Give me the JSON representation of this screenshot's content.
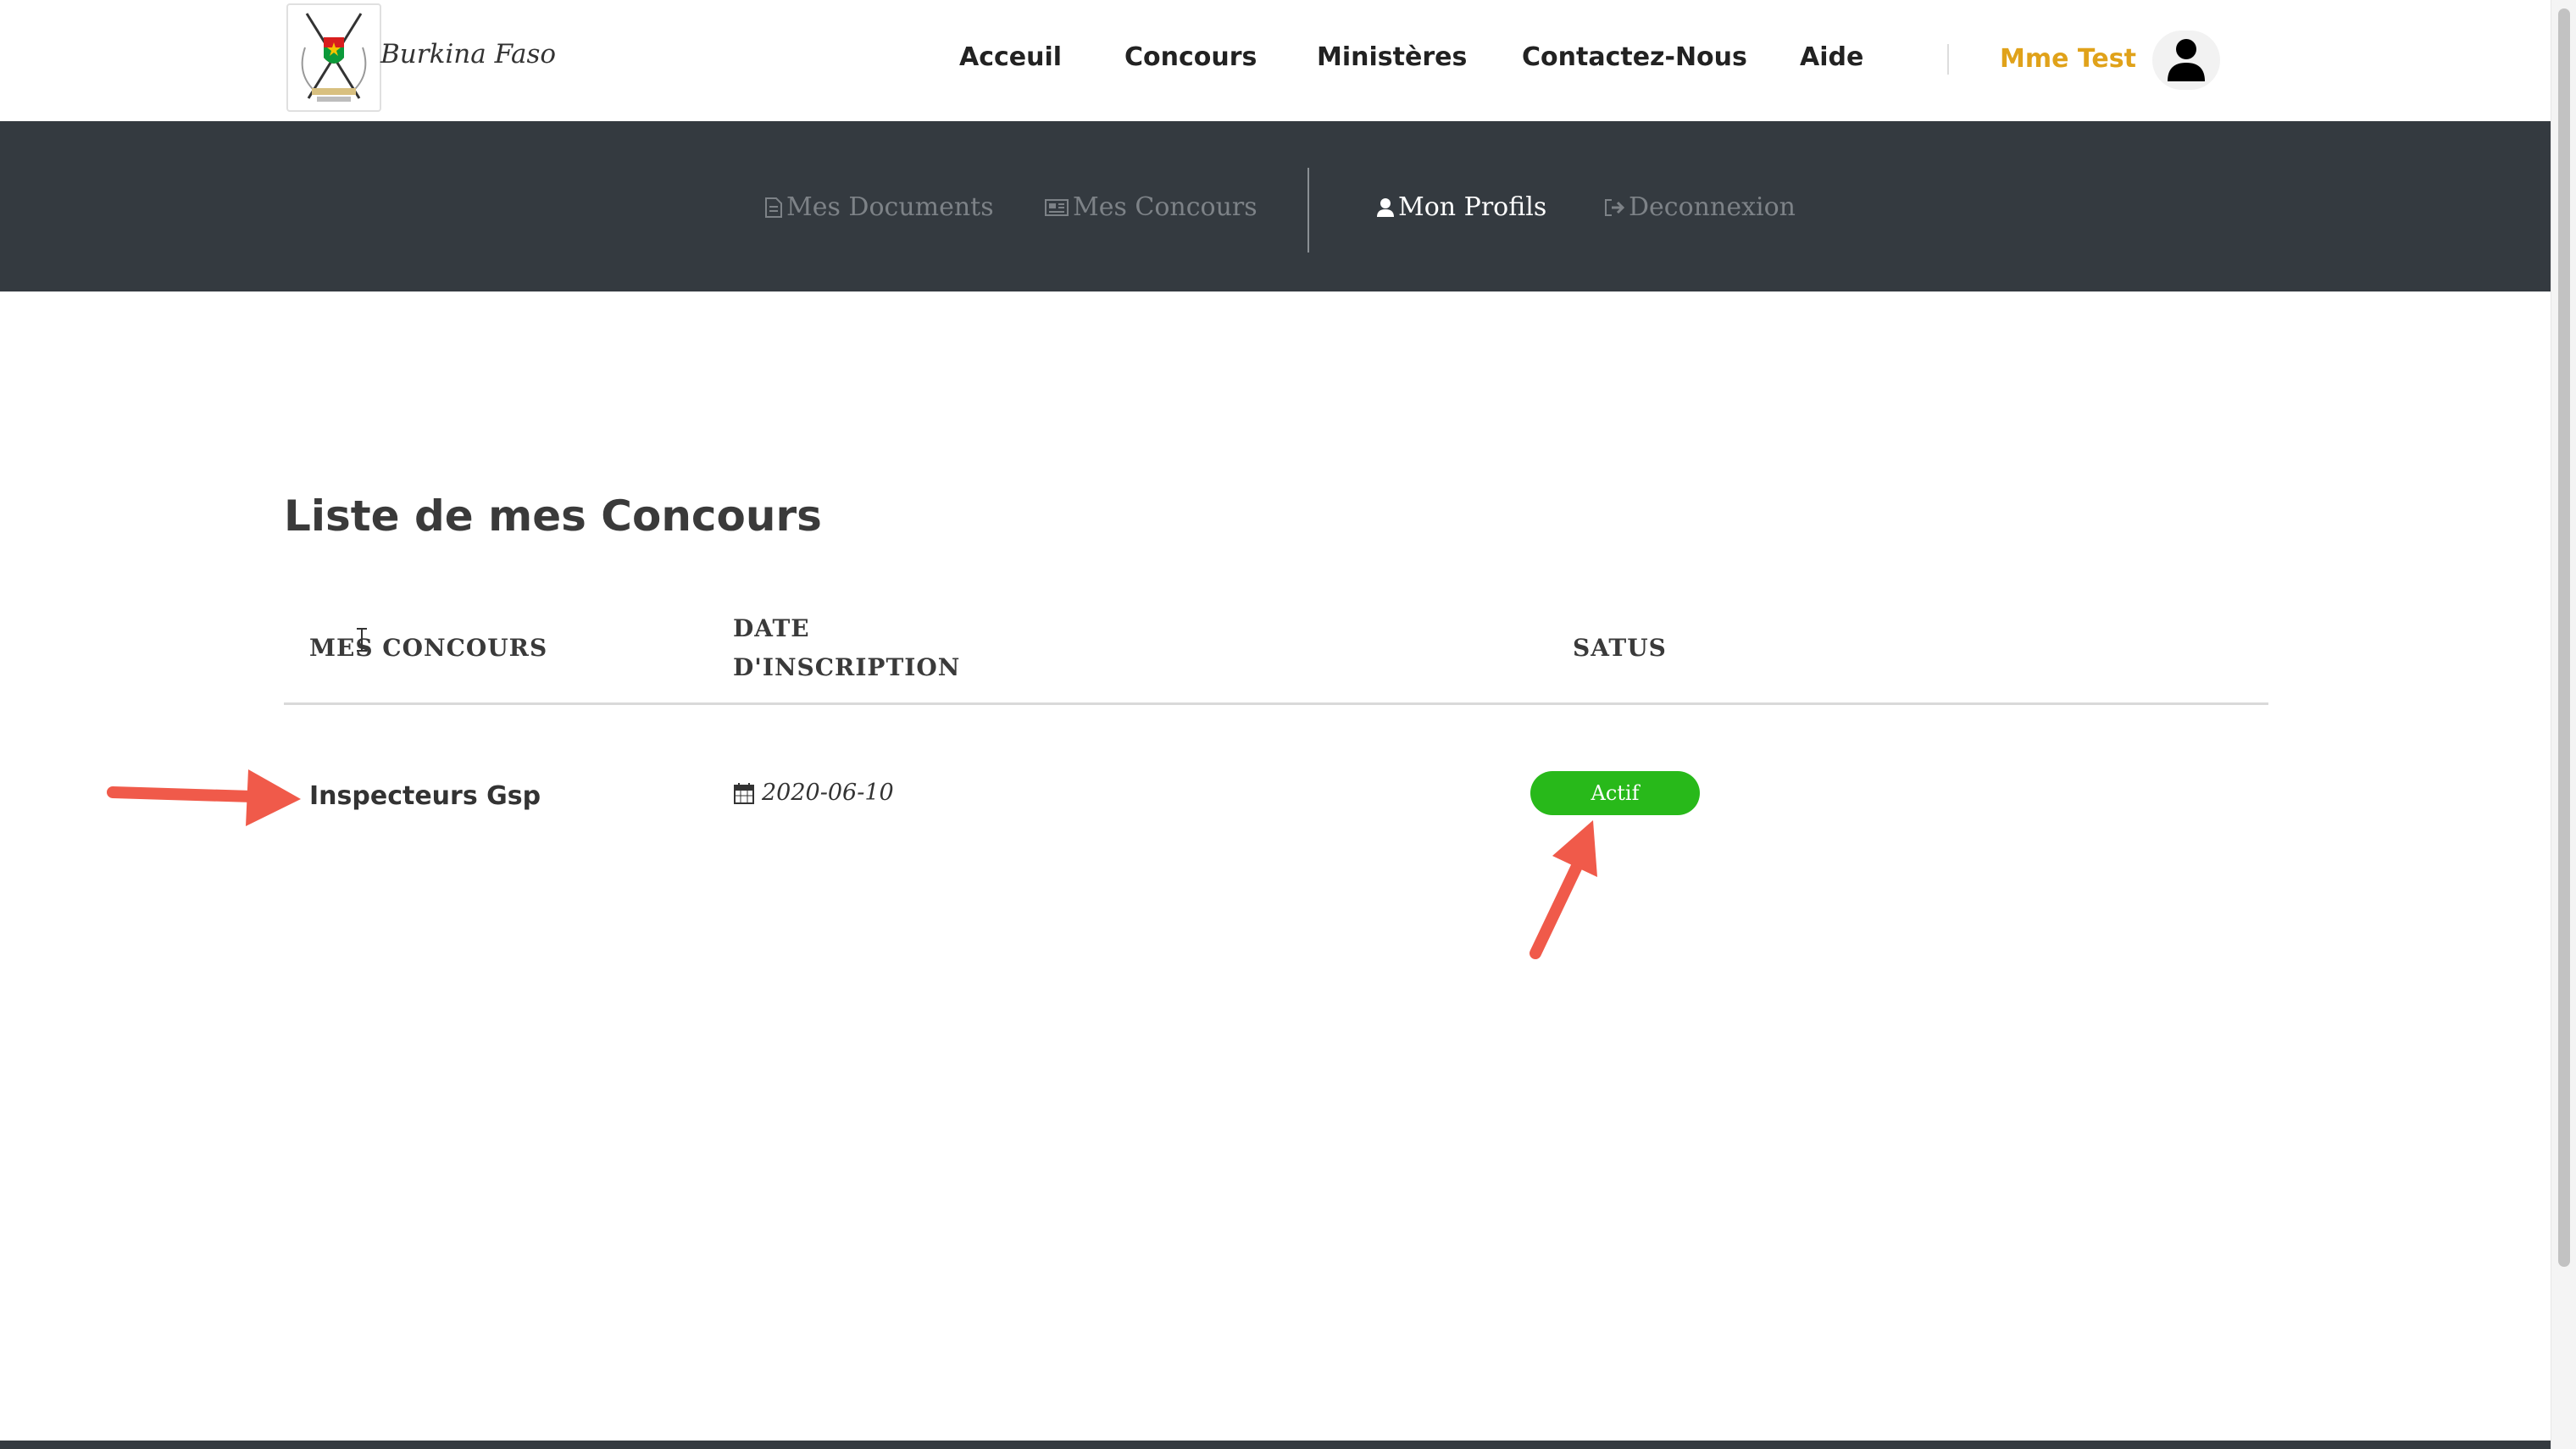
{
  "brand": {
    "name": "Burkina Faso"
  },
  "nav": {
    "items": [
      "Acceuil",
      "Concours",
      "Ministères",
      "Contactez-Nous",
      "Aide"
    ],
    "user_name": "Mme Test"
  },
  "subnav": {
    "items": [
      {
        "label": "Mes Documents",
        "icon": "document-icon",
        "active": false
      },
      {
        "label": "Mes Concours",
        "icon": "newspaper-icon",
        "active": false
      },
      {
        "label": "Mon Profils",
        "icon": "user-icon",
        "active": true
      },
      {
        "label": "Deconnexion",
        "icon": "sign-out-icon",
        "active": false
      }
    ]
  },
  "main": {
    "title": "Liste de mes Concours",
    "columns": [
      "MES CONCOURS",
      "DATE D'INSCRIPTION",
      "SATUS"
    ],
    "rows": [
      {
        "concours": "Inspecteurs Gsp",
        "date": "2020-06-10",
        "status": "Actif"
      }
    ]
  },
  "colors": {
    "subnav_bg": "#343a40",
    "user_accent": "#e0a21a",
    "status_active": "#28b91a",
    "annotation_arrow": "#f05a4a"
  }
}
